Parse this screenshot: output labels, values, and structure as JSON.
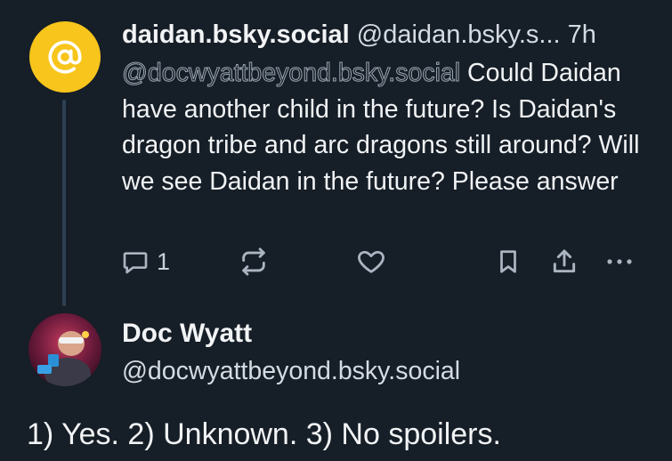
{
  "parent_post": {
    "display_name": "daidan.bsky.social",
    "handle_truncated": "@daidan.bsky.s...",
    "age": "7h",
    "mention": "@docwyattbeyond.bsky.social",
    "text": " Could Daidan have another child in the future? Is Daidan's dragon tribe and arc dragons still around? Will we see Daidan in the future? Please answer",
    "avatar_icon": "at-sign-icon",
    "avatar_color": "#f7c51b",
    "actions": {
      "reply_count": "1",
      "reply_icon": "speech-bubble-icon",
      "repost_icon": "repost-icon",
      "like_icon": "heart-icon",
      "bookmark_icon": "bookmark-icon",
      "share_icon": "share-icon",
      "more_icon": "more-dots-icon"
    }
  },
  "reply_post": {
    "display_name": "Doc Wyatt",
    "handle": "@docwyattbeyond.bsky.social",
    "text": "1) Yes. 2) Unknown. 3) No spoilers."
  },
  "colors": {
    "background": "#161e27",
    "text_primary": "#f1f3f5",
    "text_secondary": "#d5dbe2",
    "icon": "#aab5c1",
    "thread_line": "#2e4052"
  }
}
